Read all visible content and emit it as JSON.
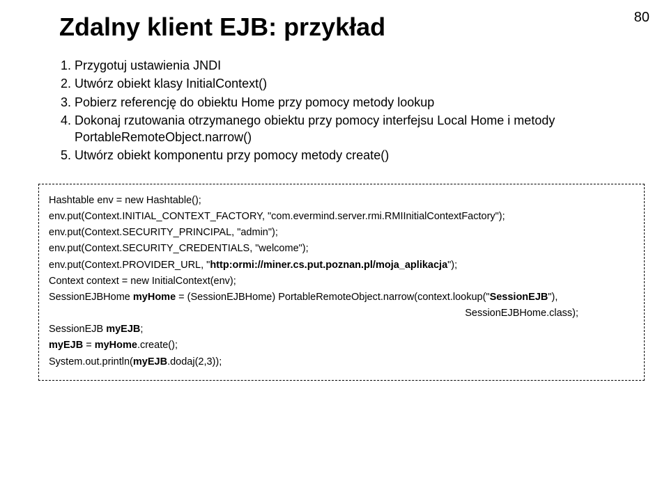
{
  "pageNumber": "80",
  "title": "Zdalny klient EJB: przykład",
  "steps": [
    "Przygotuj ustawienia JNDI",
    "Utwórz obiekt klasy InitialContext()",
    "Pobierz referencję do obiektu Home przy pomocy metody lookup",
    "Dokonaj rzutowania otrzymanego obiektu przy pomocy interfejsu Local Home i metody PortableRemoteObject.narrow()",
    "Utwórz obiekt komponentu przy pomocy metody create()"
  ],
  "code": {
    "l1": "Hashtable env = new Hashtable();",
    "l2": "env.put(Context.INITIAL_CONTEXT_FACTORY, \"com.evermind.server.rmi.RMIInitialContextFactory\");",
    "l3": "env.put(Context.SECURITY_PRINCIPAL, \"admin\");",
    "l4": "env.put(Context.SECURITY_CREDENTIALS, \"welcome\");",
    "l5a": "env.put(Context.PROVIDER_URL, \"",
    "l5b": "http:ormi://miner.cs.put.poznan.pl/moja_aplikacja",
    "l5c": "\");",
    "l6": "Context context = new InitialContext(env);",
    "l7a": "SessionEJBHome ",
    "l7b": "myHome",
    "l7c": " = (SessionEJBHome) PortableRemoteObject.narrow(context.lookup(\"",
    "l7d": "SessionEJB",
    "l7e": "\"),",
    "l8": "SessionEJBHome.class);",
    "l9a": "SessionEJB ",
    "l9b": "myEJB",
    "l9c": ";",
    "l10a": "myEJB",
    "l10b": " = ",
    "l10c": "myHome",
    "l10d": ".create();",
    "l11a": "System.out.println(",
    "l11b": "myEJB",
    "l11c": ".dodaj(2,3));"
  }
}
